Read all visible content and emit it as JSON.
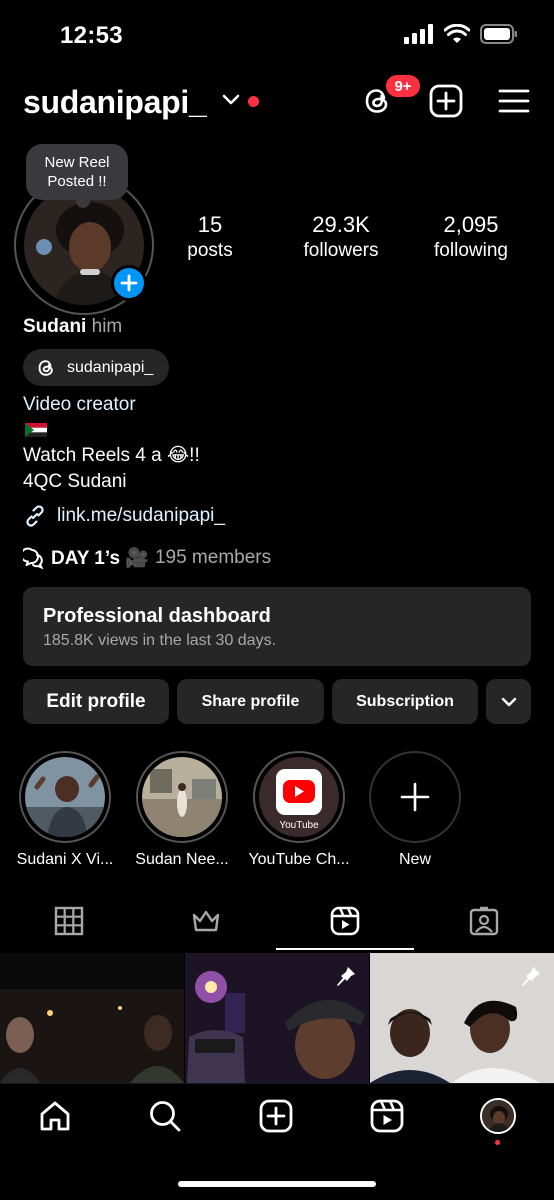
{
  "status_bar": {
    "time": "12:53"
  },
  "header": {
    "username": "sudanipapi_",
    "threads_badge": "9+"
  },
  "note": {
    "line1": "New Reel",
    "line2": "Posted !!"
  },
  "stats": [
    {
      "value": "15",
      "label": "posts"
    },
    {
      "value": "29.3K",
      "label": "followers"
    },
    {
      "value": "2,095",
      "label": "following"
    }
  ],
  "bio": {
    "name": "Sudani",
    "pronouns": "him",
    "threads_handle": "sudanipapi_",
    "category": "Video creator",
    "line_watch": "Watch Reels 4 a 😂!!",
    "line_4qc": "4QC Sudani",
    "link": "link.me/sudanipapi_",
    "channel_name": "DAY 1’s 🎥",
    "channel_members": "195 members"
  },
  "dashboard": {
    "title": "Professional dashboard",
    "subtitle": "185.8K views in the last 30 days."
  },
  "buttons": {
    "edit": "Edit profile",
    "share": "Share profile",
    "subscription": "Subscription"
  },
  "highlights": [
    {
      "label": "Sudani X Vi..."
    },
    {
      "label": "Sudan Nee..."
    },
    {
      "label": "YouTube Ch...",
      "badge_text": "YouTube"
    },
    {
      "label": "New"
    }
  ],
  "colors": {
    "accent_blue": "#0095f6",
    "notification_red": "#ff3040",
    "surface": "#262626"
  }
}
